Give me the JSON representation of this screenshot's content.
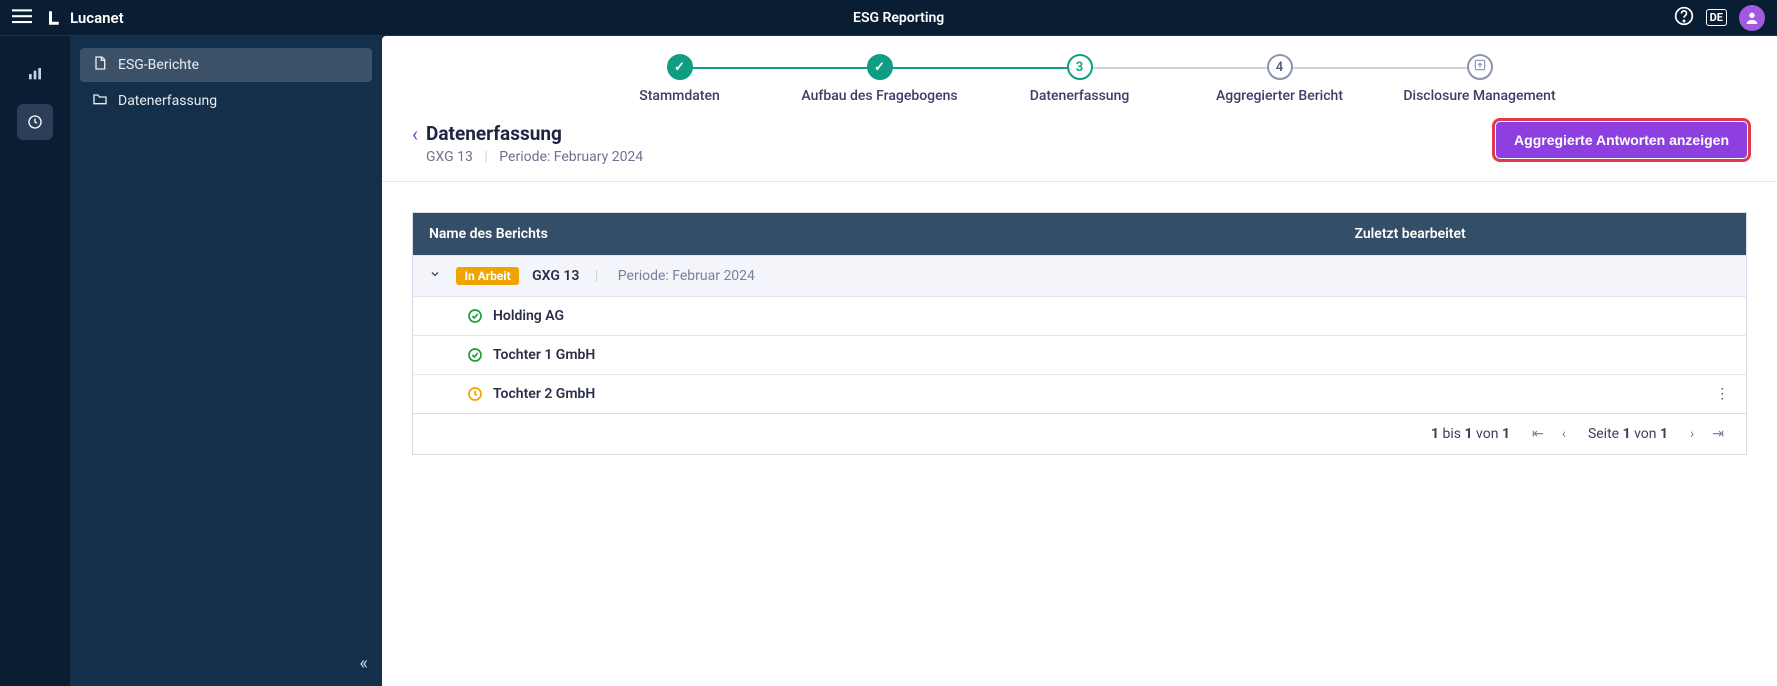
{
  "app": {
    "title": "ESG Reporting",
    "brand": "Lucanet",
    "lang": "DE"
  },
  "sidebar": {
    "items": [
      {
        "label": "ESG-Berichte",
        "icon": "file"
      },
      {
        "label": "Datenerfassung",
        "icon": "folder"
      }
    ]
  },
  "stepper": [
    {
      "label": "Stammdaten",
      "state": "done",
      "mark": "✓"
    },
    {
      "label": "Aufbau des Fragebogens",
      "state": "done",
      "mark": "✓"
    },
    {
      "label": "Datenerfassung",
      "state": "current",
      "mark": "3"
    },
    {
      "label": "Aggregierter Bericht",
      "state": "pending",
      "mark": "4"
    },
    {
      "label": "Disclosure Management",
      "state": "pending",
      "mark": ""
    }
  ],
  "page": {
    "title": "Datenerfassung",
    "report_code": "GXG 13",
    "period_label": "Periode: February 2024",
    "action_button": "Aggregierte Antworten anzeigen"
  },
  "table": {
    "columns": [
      "Name des Berichts",
      "Zuletzt bearbeitet",
      ""
    ],
    "group": {
      "status_badge": "In Arbeit",
      "name": "GXG 13",
      "period": "Periode: Februar 2024"
    },
    "rows": [
      {
        "name": "Holding AG",
        "status": "done"
      },
      {
        "name": "Tochter 1 GmbH",
        "status": "done"
      },
      {
        "name": "Tochter 2 GmbH",
        "status": "pending"
      }
    ]
  },
  "pager": {
    "range_a": "1",
    "range_b": "1",
    "range_total": "1",
    "range_word_bis": "bis",
    "range_word_von": "von",
    "page_label_a": "Seite",
    "page_current": "1",
    "page_label_b": "von",
    "page_total": "1"
  }
}
